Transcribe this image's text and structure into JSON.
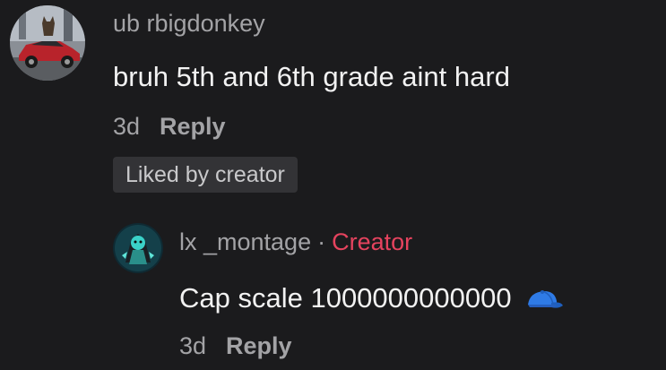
{
  "comment": {
    "username": "ub  rbigdonkey",
    "text": "bruh 5th and 6th grade aint hard",
    "time": "3d",
    "reply_label": "Reply",
    "liked_badge": "Liked by creator",
    "avatar_icon": "car-avatar"
  },
  "reply": {
    "username": "lx _montage",
    "separator": "·",
    "creator_label": "Creator",
    "text": "Cap scale 1000000000000",
    "emoji_icon": "blue-cap-icon",
    "time": "3d",
    "reply_label": "Reply",
    "avatar_icon": "character-avatar"
  },
  "colors": {
    "background": "#1b1b1d",
    "creator": "#e5435e",
    "muted": "#a3a3a6",
    "text": "#f2f2f2"
  }
}
